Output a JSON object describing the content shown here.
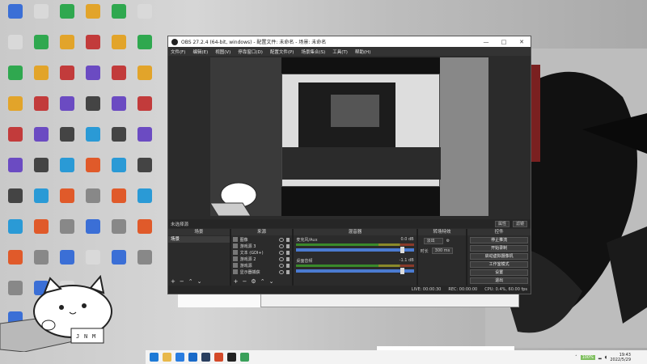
{
  "obs": {
    "title": "OBS 27.2.4 (64-bit, windows) - 配置文件: 未命名 - 场景: 未命名",
    "window_controls": [
      "—",
      "□",
      "✕"
    ],
    "menu": [
      "文件(F)",
      "编辑(E)",
      "视图(V)",
      "停靠窗口(D)",
      "配置文件(P)",
      "场景集合(S)",
      "工具(T)",
      "帮助(H)"
    ],
    "no_source_selected": "未选择源",
    "properties_button": "属性",
    "filters_button": "滤镜",
    "docks": {
      "scenes": "场景",
      "sources": "来源",
      "mixer": "混音器",
      "transitions": "转场特效",
      "controls": "控件"
    },
    "scenes": [
      "场景"
    ],
    "sources": [
      {
        "name": "图像",
        "icon": "image-icon"
      },
      {
        "name": "游戏源 3",
        "icon": "gamepad-icon"
      },
      {
        "name": "文本 (GDI+)",
        "icon": "text-icon"
      },
      {
        "name": "游戏源 2",
        "icon": "gamepad-icon"
      },
      {
        "name": "游戏源",
        "icon": "gamepad-icon"
      },
      {
        "name": "显示器捕获",
        "icon": "monitor-icon"
      }
    ],
    "mixer": [
      {
        "name": "麦克风/Aux",
        "db": "0.0 dB"
      },
      {
        "name": "桌面音频",
        "db": "-1.1 dB"
      }
    ],
    "transition": {
      "type": "淡出",
      "duration_label": "时长",
      "duration": "300 ms"
    },
    "controls": [
      "停止推流",
      "开始录制",
      "启动虚拟摄像机",
      "工作室模式",
      "设置",
      "退出"
    ],
    "status": [
      "LIVE: 00:00:30",
      "REC: 00:00:00",
      "CPU: 0.4%, 60.00 fps"
    ]
  },
  "taskbar": {
    "battery": "100%",
    "time": "19:43",
    "date": "2022/5/29"
  },
  "bongo_keys": [
    "J",
    "N",
    "M"
  ],
  "colors": {
    "obs_bg": "#2b2b2b",
    "accent_blue": "#4b7bd1",
    "taskbar": "#f3f3f3"
  }
}
